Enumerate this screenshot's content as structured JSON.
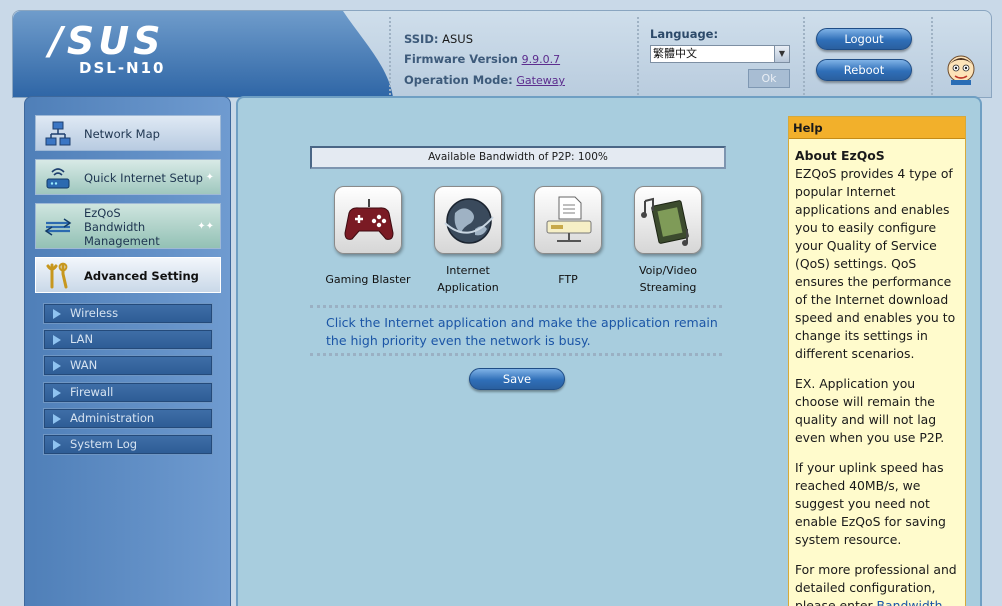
{
  "header": {
    "logo": "/SUS",
    "model": "DSL-N10",
    "ssid_label": "SSID:",
    "ssid_value": "ASUS",
    "firmware_label": "Firmware Version",
    "firmware_value": "9.9.0.7",
    "mode_label": "Operation Mode:",
    "mode_value": "Gateway",
    "language_label": "Language:",
    "language_selected": "繁體中文",
    "ok_label": "Ok",
    "logout_label": "Logout",
    "reboot_label": "Reboot"
  },
  "sidebar": {
    "network_map": "Network Map",
    "quick_setup": "Quick Internet Setup",
    "ezqos_line1": "EzQoS",
    "ezqos_line2": "Bandwidth",
    "ezqos_line3": "Management",
    "advanced": "Advanced Setting",
    "sub_items": [
      "Wireless",
      "LAN",
      "WAN",
      "Firewall",
      "Administration",
      "System Log"
    ]
  },
  "main": {
    "bandwidth_label": "Available Bandwidth of P2P: 100%",
    "apps": [
      {
        "line1": "Gaming Blaster",
        "line2": ""
      },
      {
        "line1": "Internet",
        "line2": "Application"
      },
      {
        "line1": "FTP",
        "line2": ""
      },
      {
        "line1": "Voip/Video",
        "line2": "Streaming"
      }
    ],
    "hint": "Click the Internet application and make the application remain the high priority even the network is busy.",
    "save_label": "Save"
  },
  "help": {
    "title": "Help",
    "heading": "About EzQoS",
    "p1": "EZQoS provides 4 type of popular Internet applications and enables you to easily configure your Quality of Service (QoS) settings. QoS ensures the performance of the Internet download speed and enables you to change its settings in different scenarios.",
    "p2": "EX. Application you choose will remain the quality and will not lag even when you use P2P.",
    "p3": "If your uplink speed has reached 40MB/s, we suggest you need not enable EzQoS for saving system resource.",
    "p4_text": "For more professional and detailed configuration, please enter",
    "p4_link": "Bandwidth"
  },
  "colors": {
    "accent_blue": "#2f6fb8",
    "help_header": "#f2b02b",
    "main_bg": "#a8cdde",
    "hint_text": "#1b55a6"
  }
}
